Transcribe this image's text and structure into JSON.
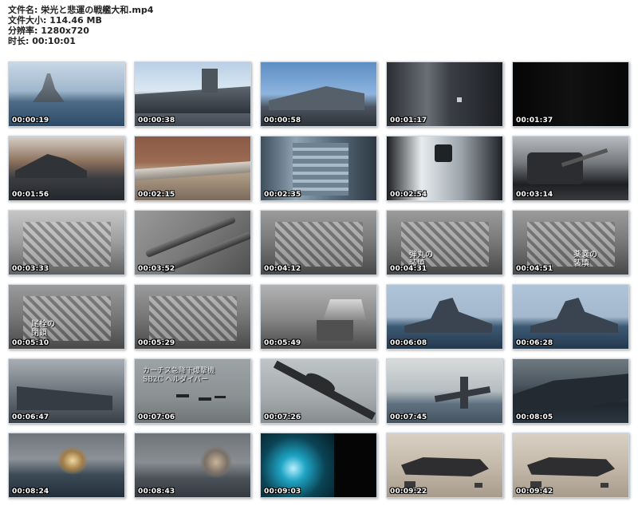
{
  "header": {
    "line1": "文件名: 栄光と悲運の戦艦大和.mp4",
    "line2": "文件大小: 114.46 MB",
    "line3": "分辨率: 1280x720",
    "line4": "时长: 00:10:01"
  },
  "thumbnails": [
    {
      "time": "00:00:19",
      "icon": "battleship-bow-ocean",
      "overlay": ""
    },
    {
      "time": "00:00:38",
      "icon": "battleship-deck-sky",
      "overlay": ""
    },
    {
      "time": "00:00:58",
      "icon": "battleship-turret-sky",
      "overlay": ""
    },
    {
      "time": "00:01:17",
      "icon": "dark-corridor",
      "overlay": ""
    },
    {
      "time": "00:01:37",
      "icon": "dark-frame",
      "overlay": ""
    },
    {
      "time": "00:01:56",
      "icon": "battleship-model-museum",
      "overlay": ""
    },
    {
      "time": "00:02:15",
      "icon": "gun-barrel-brick",
      "overlay": ""
    },
    {
      "time": "00:02:35",
      "icon": "turret-machinery",
      "overlay": ""
    },
    {
      "time": "00:02:54",
      "icon": "white-hull-interior",
      "overlay": ""
    },
    {
      "time": "00:03:14",
      "icon": "turret-model-display",
      "overlay": ""
    },
    {
      "time": "00:03:33",
      "icon": "gun-breech-mechanism",
      "overlay": ""
    },
    {
      "time": "00:03:52",
      "icon": "gun-barrels",
      "overlay": ""
    },
    {
      "time": "00:04:12",
      "icon": "ammunition-hoist",
      "overlay": ""
    },
    {
      "time": "00:04:31",
      "icon": "ammunition-hoist",
      "overlay": "弾丸の\n装填"
    },
    {
      "time": "00:04:51",
      "icon": "ammunition-hoist",
      "overlay": "薬嚢の\n装填"
    },
    {
      "time": "00:05:10",
      "icon": "ammunition-hoist",
      "overlay": "尾栓の\n閉鎖"
    },
    {
      "time": "00:05:29",
      "icon": "ammunition-hoist",
      "overlay": ""
    },
    {
      "time": "00:05:49",
      "icon": "turret-exterior",
      "overlay": ""
    },
    {
      "time": "00:06:08",
      "icon": "battleship-at-sea",
      "overlay": ""
    },
    {
      "time": "00:06:28",
      "icon": "battleship-at-sea",
      "overlay": ""
    },
    {
      "time": "00:06:47",
      "icon": "battleship-guns",
      "overlay": ""
    },
    {
      "time": "00:07:06",
      "icon": "aircraft-formation",
      "overlay": "カーチス急降下爆撃機\nSB2C ヘルダイバー"
    },
    {
      "time": "00:07:26",
      "icon": "aircraft-dive",
      "overlay": ""
    },
    {
      "time": "00:07:45",
      "icon": "aircraft-attack-ship",
      "overlay": ""
    },
    {
      "time": "00:08:05",
      "icon": "damaged-battleship",
      "overlay": ""
    },
    {
      "time": "00:08:24",
      "icon": "ship-explosion",
      "overlay": ""
    },
    {
      "time": "00:08:43",
      "icon": "ship-explosion-smoke",
      "overlay": ""
    },
    {
      "time": "00:09:03",
      "icon": "underwater-explosion",
      "overlay": ""
    },
    {
      "time": "00:09:22",
      "icon": "wreck-model-seabed",
      "overlay": ""
    },
    {
      "time": "00:09:42",
      "icon": "wreck-model-seabed",
      "overlay": ""
    }
  ],
  "colors": {
    "background": "#ffffff",
    "timestamp": "#ffffff"
  }
}
